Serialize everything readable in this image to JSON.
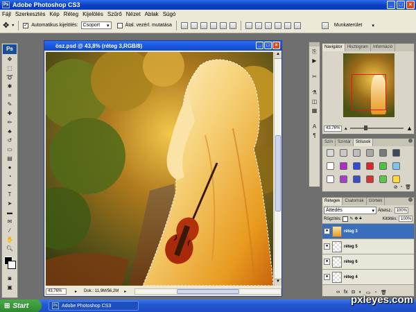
{
  "app": {
    "title": "Adobe Photoshop CS3",
    "logo": "Ps"
  },
  "menu": [
    "Fájl",
    "Szerkesztés",
    "Kép",
    "Réteg",
    "Kijelölés",
    "Szűrő",
    "Nézet",
    "Ablak",
    "Súgó"
  ],
  "options": {
    "auto_select_label": "Automatikus kijelölés:",
    "auto_select_checked": true,
    "auto_select_mode": "Csoport",
    "show_transform_label": "Átal. vezérl. mutatása",
    "show_transform_checked": false,
    "workspace_label": "Munkaterület"
  },
  "document": {
    "title": "ösz.psd @ 43,8% (réteg 3,RGB/8)",
    "zoom": "43,76%",
    "doc_info": "Dok.: 11,9M/56,2M"
  },
  "navigator": {
    "tabs": [
      "Navigátor",
      "Hisztogram",
      "Információ"
    ],
    "zoom": "43.76%"
  },
  "styles_panel": {
    "tabs": [
      "Szín",
      "Színtár",
      "Stílusok"
    ],
    "swatches": [
      "#d8d8d8",
      "#c8c8c8",
      "#bdbdbd",
      "#a8a8a8",
      "#7a7a7a",
      "#3c4b5a",
      "#ffffff",
      "#b02cc8",
      "#2b4bd8",
      "#d8282c",
      "#4ac43a",
      "#7fc2ee",
      "#ffffff",
      "#a53fc8",
      "#3a4ec5",
      "#d43434",
      "#56c84a",
      "#ffd83a"
    ]
  },
  "layers_panel": {
    "tabs": [
      "Rétegek",
      "Csatornák",
      "Görbék"
    ],
    "blend_mode": "Áttedés",
    "opacity_label": "Áttetsz.:",
    "opacity": "100%",
    "lock_label": "Rögzítés:",
    "fill_label": "Kitöltés:",
    "fill": "100%",
    "layers": [
      {
        "name": "réteg 3",
        "selected": true
      },
      {
        "name": "réteg 5",
        "selected": false
      },
      {
        "name": "réteg 6",
        "selected": false
      },
      {
        "name": "réteg 4",
        "selected": false
      }
    ]
  },
  "taskbar": {
    "start_label": "Start",
    "item_label": "Adobe Photoshop CS3"
  },
  "watermark": "pxleyes.com",
  "icons": {
    "move": "move-arrow",
    "marquee": "dashed-rectangle",
    "lasso": "lasso",
    "wand": "magic-wand",
    "crop": "crop",
    "eyedropper": "eyedropper"
  }
}
